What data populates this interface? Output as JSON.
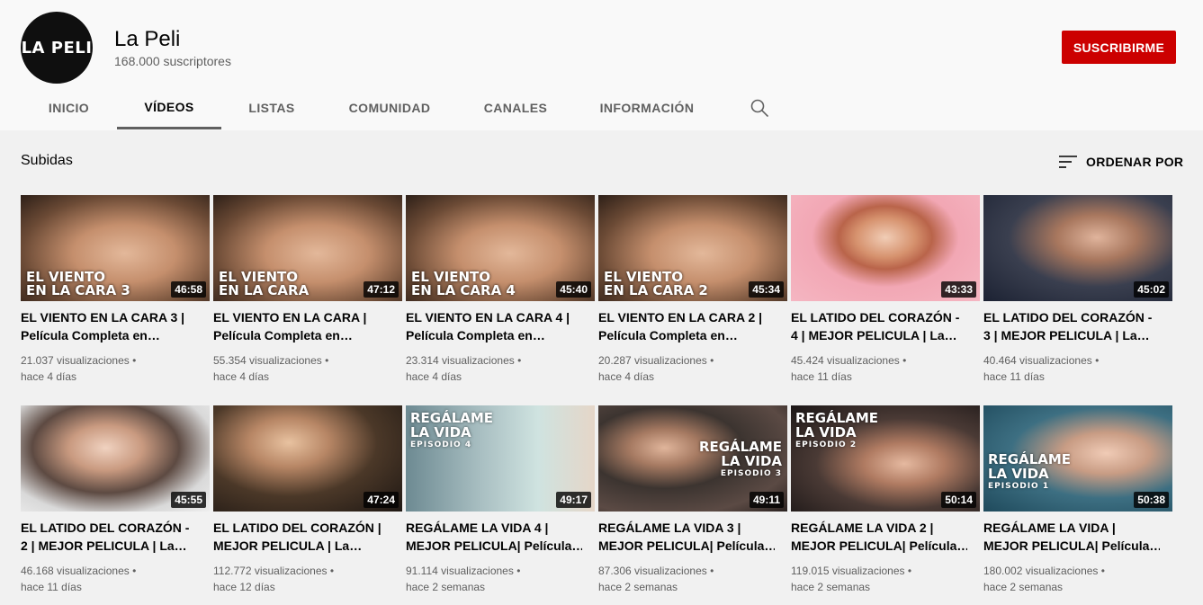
{
  "channel": {
    "avatar_text": "LA PELI",
    "name": "La Peli",
    "subscribers": "168.000 suscriptores",
    "subscribe_label": "SUSCRIBIRME"
  },
  "tabs": [
    {
      "label": "INICIO"
    },
    {
      "label": "VÍDEOS"
    },
    {
      "label": "LISTAS"
    },
    {
      "label": "COMUNIDAD"
    },
    {
      "label": "CANALES"
    },
    {
      "label": "INFORMACIÓN"
    }
  ],
  "section": {
    "title": "Subidas",
    "sort_label": "ORDENAR POR"
  },
  "videos": [
    {
      "overlay_1": "EL VIENTO",
      "overlay_2": "EN LA CARA 3",
      "duration": "46:58",
      "title_1": "EL VIENTO EN LA CARA 3 |",
      "title_2": "Película Completa en…",
      "views": "21.037 visualizaciones •",
      "age": "hace 4 días"
    },
    {
      "overlay_1": "EL VIENTO",
      "overlay_2": "EN LA CARA",
      "duration": "47:12",
      "title_1": "EL VIENTO EN LA CARA |",
      "title_2": "Película Completa en…",
      "views": "55.354 visualizaciones •",
      "age": "hace 4 días"
    },
    {
      "overlay_1": "EL VIENTO",
      "overlay_2": "EN LA CARA 4",
      "duration": "45:40",
      "title_1": "EL VIENTO EN LA CARA 4 |",
      "title_2": "Película Completa en…",
      "views": "23.314 visualizaciones •",
      "age": "hace 4 días"
    },
    {
      "overlay_1": "EL VIENTO",
      "overlay_2": "EN LA CARA 2",
      "duration": "45:34",
      "title_1": "EL VIENTO EN LA CARA 2 |",
      "title_2": "Película Completa en…",
      "views": "20.287 visualizaciones •",
      "age": "hace 4 días"
    },
    {
      "duration": "43:33",
      "title_1": "EL LATIDO DEL CORAZÓN -",
      "title_2": "4 | MEJOR PELICULA | La…",
      "views": "45.424 visualizaciones •",
      "age": "hace 11 días"
    },
    {
      "duration": "45:02",
      "title_1": "EL LATIDO DEL CORAZÓN -",
      "title_2": "3 | MEJOR PELICULA | La…",
      "views": "40.464 visualizaciones •",
      "age": "hace 11 días"
    },
    {
      "duration": "45:55",
      "title_1": "EL LATIDO DEL CORAZÓN -",
      "title_2": "2 | MEJOR PELICULA | La…",
      "views": "46.168 visualizaciones •",
      "age": "hace 11 días"
    },
    {
      "duration": "47:24",
      "title_1": "EL LATIDO DEL CORAZÓN |",
      "title_2": "MEJOR PELICULA | La…",
      "views": "112.772 visualizaciones •",
      "age": "hace 12 días"
    },
    {
      "overlay_1": "REGÁLAME",
      "overlay_2": "LA VIDA",
      "overlay_3": "EPISODIO 4",
      "duration": "49:17",
      "title_1": "REGÁLAME LA VIDA 4 |",
      "title_2": "MEJOR PELICULA| Película…",
      "views": "91.114 visualizaciones •",
      "age": "hace 2 semanas"
    },
    {
      "overlay_1": "REGÁLAME",
      "overlay_2": "LA VIDA",
      "overlay_3": "EPISODIO 3",
      "duration": "49:11",
      "title_1": "REGÁLAME LA VIDA 3 |",
      "title_2": "MEJOR PELICULA| Película…",
      "views": "87.306 visualizaciones •",
      "age": "hace 2 semanas"
    },
    {
      "overlay_1": "REGÁLAME",
      "overlay_2": "LA VIDA",
      "overlay_3": "EPISODIO 2",
      "duration": "50:14",
      "title_1": "REGÁLAME LA VIDA 2 |",
      "title_2": "MEJOR PELICULA| Película…",
      "views": "119.015 visualizaciones •",
      "age": "hace 2 semanas"
    },
    {
      "overlay_1": "REGÁLAME",
      "overlay_2": "LA VIDA",
      "overlay_3": "EPISODIO 1",
      "duration": "50:38",
      "title_1": "REGÁLAME LA VIDA |",
      "title_2": "MEJOR PELICULA| Película…",
      "views": "180.002 visualizaciones •",
      "age": "hace 2 semanas"
    }
  ],
  "colors": {
    "subscribe": "#cc0000",
    "header_bg": "#f9f9f9",
    "page_bg": "#f1f1f1",
    "secondary_text": "#606060"
  },
  "icons": {
    "search": "search-icon",
    "sort": "sort-icon"
  }
}
